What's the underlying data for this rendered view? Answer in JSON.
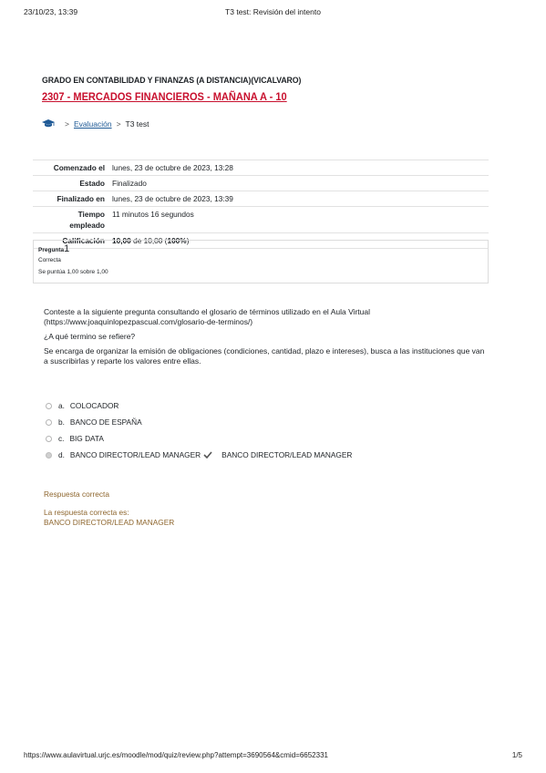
{
  "print_header": {
    "date": "23/10/23, 13:39",
    "title": "T3 test: Revisión del intento"
  },
  "course": {
    "degree": "GRADO EN CONTABILIDAD Y FINANZAS (A DISTANCIA)(VICALVARO)",
    "subject": "2307 - MERCADOS FINANCIEROS - MAÑANA A - 10"
  },
  "breadcrumb": {
    "section": "Evaluación",
    "current": "T3 test"
  },
  "summary": {
    "started_label": "Comenzado el",
    "started_value": "lunes, 23 de octubre de 2023, 13:28",
    "state_label": "Estado",
    "state_value": "Finalizado",
    "finished_label": "Finalizado en",
    "finished_value": "lunes, 23 de octubre de 2023, 13:39",
    "time_label_1": "Tiempo",
    "time_label_2": "empleado",
    "time_value": "11 minutos 16 segundos",
    "grade_label": "Calificación",
    "grade_score": "10,00",
    "grade_of": "de 10,00 (",
    "grade_percent": "100%",
    "grade_close": ")"
  },
  "question_info": {
    "label": "Pregunta",
    "number": "1",
    "status": "Correcta",
    "mark": "Se puntúa 1,00 sobre 1,00"
  },
  "question": {
    "intro": "Conteste a la siguiente pregunta consultando el glosario de términos utilizado en el Aula Virtual (https://www.joaquinlopezpascual.com/glosario-de-terminos/)",
    "ask": "¿A qué termino se refiere?",
    "definition": "Se encarga de organizar la emisión de obligaciones (condiciones, cantidad, plazo e intereses), busca a las instituciones que van a suscribirlas y reparte los valores entre ellas."
  },
  "answers": [
    {
      "letter": "a.",
      "text": "COLOCADOR"
    },
    {
      "letter": "b.",
      "text": "BANCO DE ESPAÑA"
    },
    {
      "letter": "c.",
      "text": "BIG DATA"
    },
    {
      "letter": "d.",
      "text": "BANCO DIRECTOR/LEAD MANAGER",
      "feedback": "BANCO DIRECTOR/LEAD MANAGER"
    }
  ],
  "feedback": {
    "result": "Respuesta correcta",
    "right_label": "La respuesta correcta es:",
    "right_answer": "BANCO DIRECTOR/LEAD MANAGER"
  },
  "print_footer": {
    "url": "https://www.aulavirtual.urjc.es/moodle/mod/quiz/review.php?attempt=3690564&cmid=6652331",
    "page": "1/5"
  },
  "colors": {
    "subject_red": "#c8102e",
    "link_blue": "#1f5a96",
    "feedback_brown": "#8e662e"
  },
  "icons": {
    "breadcrumb_home": "graduation-cap-icon",
    "correct": "check-icon"
  }
}
